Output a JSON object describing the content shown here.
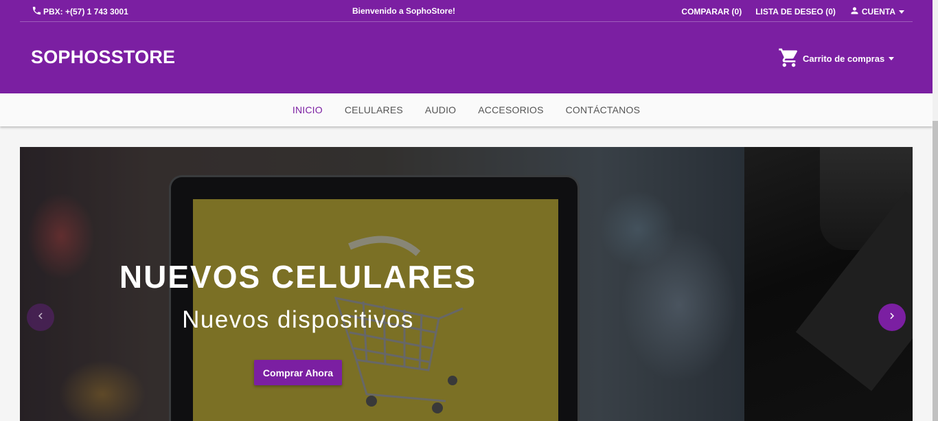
{
  "topbar": {
    "phone": "PBX: +(57) 1 743 3001",
    "welcome": "Bienvenido a SophoStore!",
    "compare": "COMPARAR (0)",
    "wishlist": "LISTA DE DESEO (0)",
    "account": "CUENTA"
  },
  "header": {
    "brand": "SOPHOSSTORE",
    "cart_label": "Carrito de compras"
  },
  "nav": {
    "items": [
      {
        "label": "INICIO",
        "active": true
      },
      {
        "label": "CELULARES",
        "active": false
      },
      {
        "label": "AUDIO",
        "active": false
      },
      {
        "label": "ACCESORIOS",
        "active": false
      },
      {
        "label": "CONTÁCTANOS",
        "active": false
      }
    ]
  },
  "carousel": {
    "title": "NUEVOS CELULARES",
    "subtitle": "Nuevos dispositivos",
    "cta": "Comprar Ahora"
  },
  "theme": {
    "primary": "#7b1fa2",
    "nav_bg": "#fafafa"
  },
  "icons": {
    "phone": "phone-icon",
    "account": "person-icon",
    "cart": "shopping-cart-icon",
    "prev": "chevron-left-icon",
    "next": "chevron-right-icon"
  }
}
